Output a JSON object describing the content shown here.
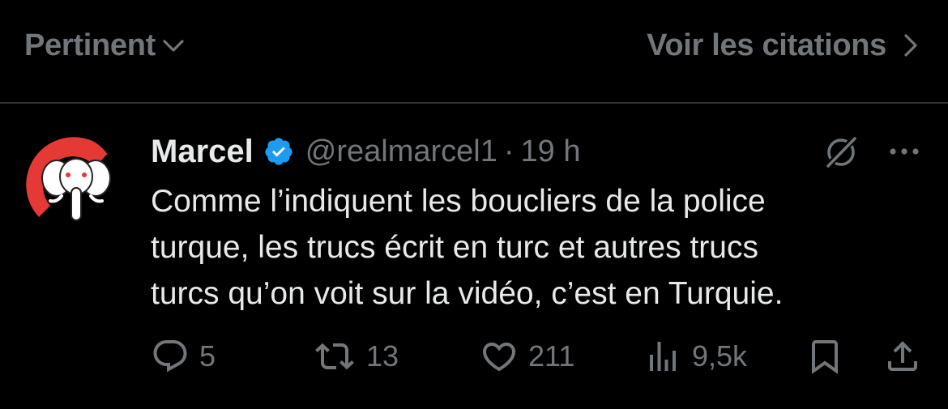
{
  "topbar": {
    "sort_label": "Pertinent",
    "quotes_label": "Voir les citations"
  },
  "tweet": {
    "author_name": "Marcel",
    "handle": "@realmarcel1",
    "separator": "·",
    "timestamp": "19 h",
    "verified": true,
    "text_lines": [
      "Comme l’indiquent les boucliers de la police",
      "turque, les trucs écrit en turc et autres trucs",
      "turcs qu’on voit sur la vidéo, c’est en Turquie."
    ]
  },
  "actions": {
    "replies": "5",
    "reposts": "13",
    "likes": "211",
    "views": "9,5k"
  },
  "colors": {
    "background": "#000000",
    "text_primary": "#e7e9ea",
    "text_secondary": "#71767b",
    "divider": "#2f3336",
    "verified_blue": "#1d9bf0",
    "avatar_red": "#e53935"
  },
  "icons": {
    "sort": "chevron-down-icon",
    "quotes": "chevron-right-icon",
    "verified": "verified-badge-icon",
    "grok": "grok-icon",
    "more": "more-icon",
    "reply": "reply-icon",
    "repost": "repost-icon",
    "like": "heart-icon",
    "views": "views-icon",
    "bookmark": "bookmark-icon",
    "share": "share-icon"
  }
}
